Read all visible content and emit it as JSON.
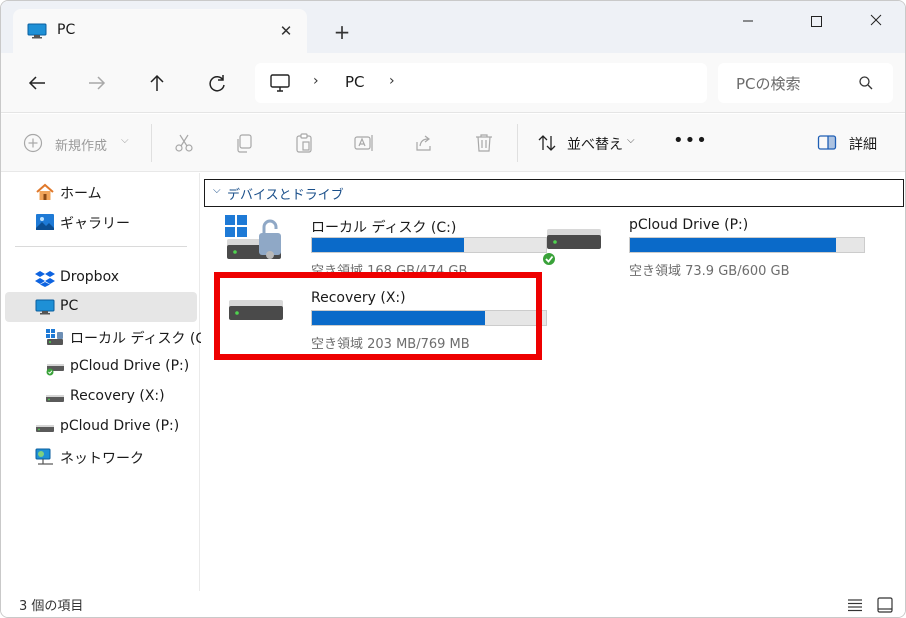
{
  "tab": {
    "title": "PC",
    "close": "✕",
    "new_tab": "+"
  },
  "window_controls": [
    "minimize",
    "maximize",
    "close"
  ],
  "breadcrumb": {
    "segments": [
      "PC"
    ],
    "sep": "›"
  },
  "search": {
    "placeholder": "PCの検索"
  },
  "toolbar": {
    "new_label": "新規作成",
    "new_chevron": "⌵",
    "sort_label": "並べ替え",
    "sort_chevron": "⌵",
    "more": "•••",
    "details_label": "詳細"
  },
  "sidebar": {
    "items": [
      {
        "label": "ホーム",
        "icon": "home-icon"
      },
      {
        "label": "ギャラリー",
        "icon": "gallery-icon"
      },
      {
        "label": "Dropbox",
        "icon": "dropbox-icon"
      },
      {
        "label": "PC",
        "icon": "pc-icon",
        "selected": true
      },
      {
        "label": "ローカル ディスク (C:)",
        "icon": "local-disk-icon"
      },
      {
        "label": "pCloud Drive (P:)",
        "icon": "pcloud-drive-icon"
      },
      {
        "label": "Recovery (X:)",
        "icon": "drive-icon"
      },
      {
        "label": "pCloud Drive (P:)",
        "icon": "drive-icon"
      },
      {
        "label": "ネットワーク",
        "icon": "network-icon"
      }
    ]
  },
  "group": {
    "title": "デバイスとドライブ",
    "chevron": "⌵"
  },
  "drives": [
    {
      "name": "ローカル ディスク (C:)",
      "space": "空き領域 168 GB/474 GB",
      "used_fraction": 0.65
    },
    {
      "name": "pCloud Drive (P:)",
      "space": "空き領域 73.9 GB/600 GB",
      "used_fraction": 0.88
    },
    {
      "name": "Recovery (X:)",
      "space": "空き領域 203 MB/769 MB",
      "used_fraction": 0.74
    }
  ],
  "status": {
    "count": "3 個の項目"
  },
  "colors": {
    "accent": "#0a6ac9",
    "highlight": "#ee0000",
    "group_title": "#1a4f8a"
  }
}
